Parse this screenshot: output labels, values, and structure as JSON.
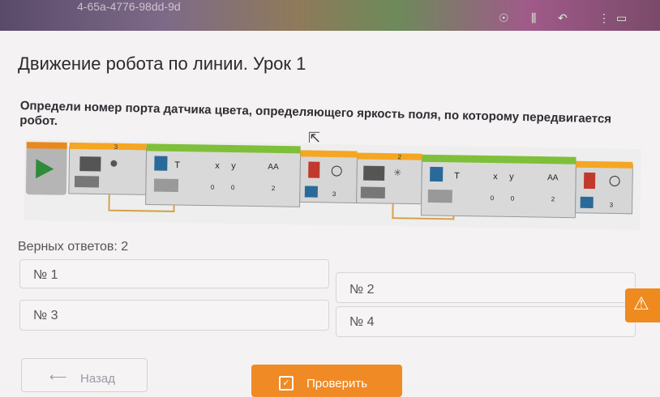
{
  "browser": {
    "url_fragment": "4-65a-4776-98dd-9d"
  },
  "page": {
    "title": "Движение робота по линии. Урок 1",
    "question": "Определи номер порта датчика цвета, определяющего яркость поля, по которому передвигается робот.",
    "correct_answers": "Верных ответов: 2"
  },
  "program": {
    "ports": [
      "3",
      "2"
    ],
    "block_labels": [
      "T",
      "x",
      "y",
      "AA",
      "T",
      "x",
      "y",
      "AA"
    ],
    "values": [
      "0",
      "0",
      "2",
      "3",
      "0",
      "0",
      "2",
      "3"
    ]
  },
  "options": [
    {
      "label": "№ 1"
    },
    {
      "label": "№ 2"
    },
    {
      "label": "№ 3"
    },
    {
      "label": "№ 4"
    }
  ],
  "buttons": {
    "back": "Назад",
    "check": "Проверить"
  },
  "colors": {
    "accent": "#f08a24",
    "block_green": "#7fbf3a",
    "block_teal": "#3a9a8a",
    "block_red": "#c0392b"
  }
}
